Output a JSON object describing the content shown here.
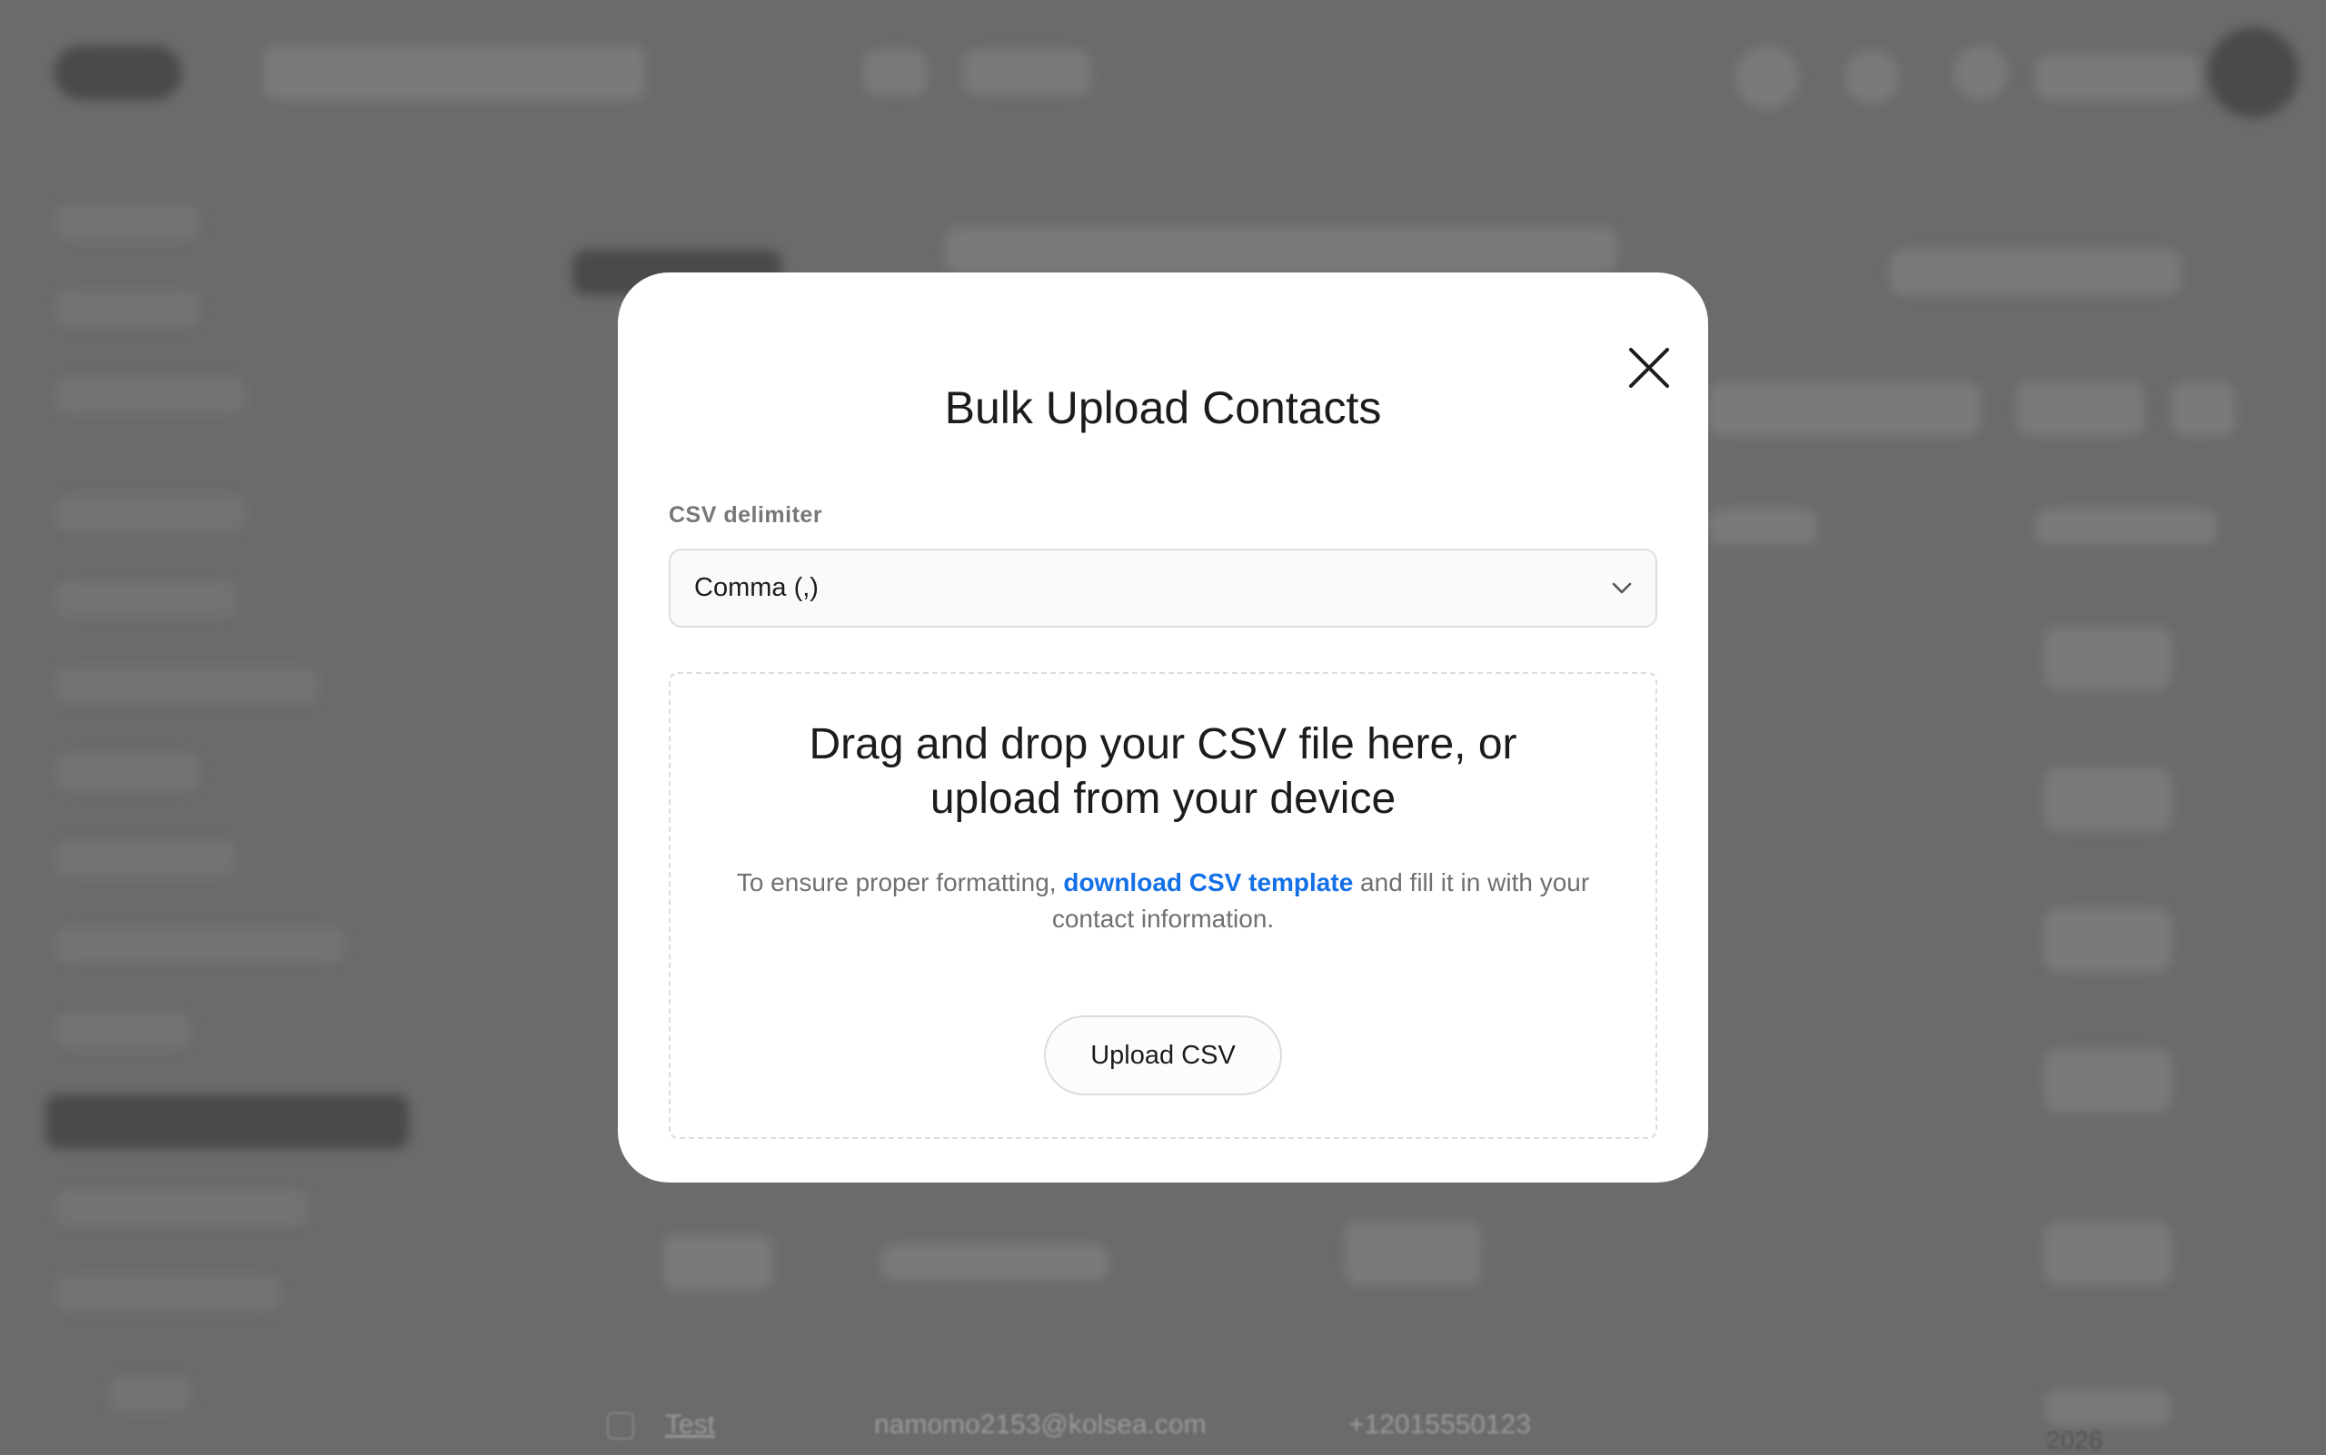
{
  "modal": {
    "title": "Bulk Upload Contacts",
    "delimiter": {
      "label": "CSV delimiter",
      "selected": "Comma (,)"
    },
    "dropzone": {
      "title_line1": "Drag and drop your CSV file here, or",
      "title_line2": "upload from your device",
      "help_prefix": "To ensure proper formatting, ",
      "help_link": "download CSV template",
      "help_suffix": " and fill it in with your contact information.",
      "upload_button": "Upload CSV"
    }
  },
  "background": {
    "row": {
      "name": "Test",
      "email": "namomo2153@kolsea.com",
      "phone": "+12015550123",
      "date_fragment": "2026"
    }
  },
  "icons": {
    "close": "close-icon",
    "chevron": "chevron-down-icon"
  },
  "colors": {
    "overlay": "#6b6b6b",
    "modal_bg": "#ffffff",
    "link": "#1470e6",
    "text": "#1c1c1c",
    "muted": "#777777"
  }
}
